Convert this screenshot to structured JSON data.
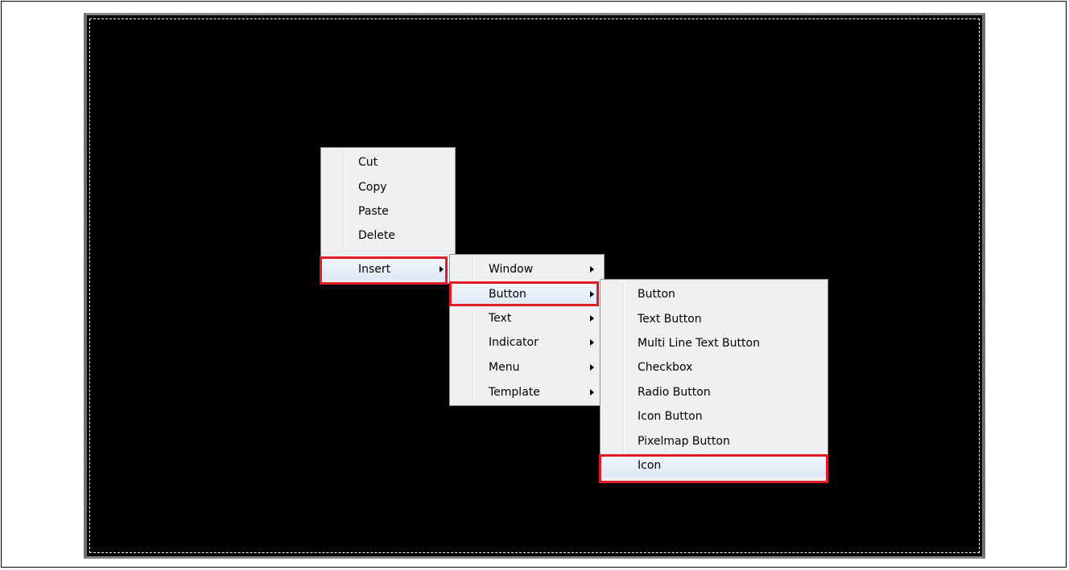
{
  "context_menu": {
    "items": [
      "Cut",
      "Copy",
      "Paste",
      "Delete"
    ],
    "insert_label": "Insert"
  },
  "insert_submenu": {
    "items": [
      "Window",
      "Button",
      "Text",
      "Indicator",
      "Menu",
      "Template"
    ]
  },
  "button_submenu": {
    "items": [
      "Button",
      "Text Button",
      "Multi Line Text Button",
      "Checkbox",
      "Radio Button",
      "Icon Button",
      "Pixelmap Button",
      "Icon"
    ]
  },
  "colors": {
    "canvas": "#000000",
    "menu_bg": "#f0f0f0",
    "highlight": "#e01c24"
  }
}
